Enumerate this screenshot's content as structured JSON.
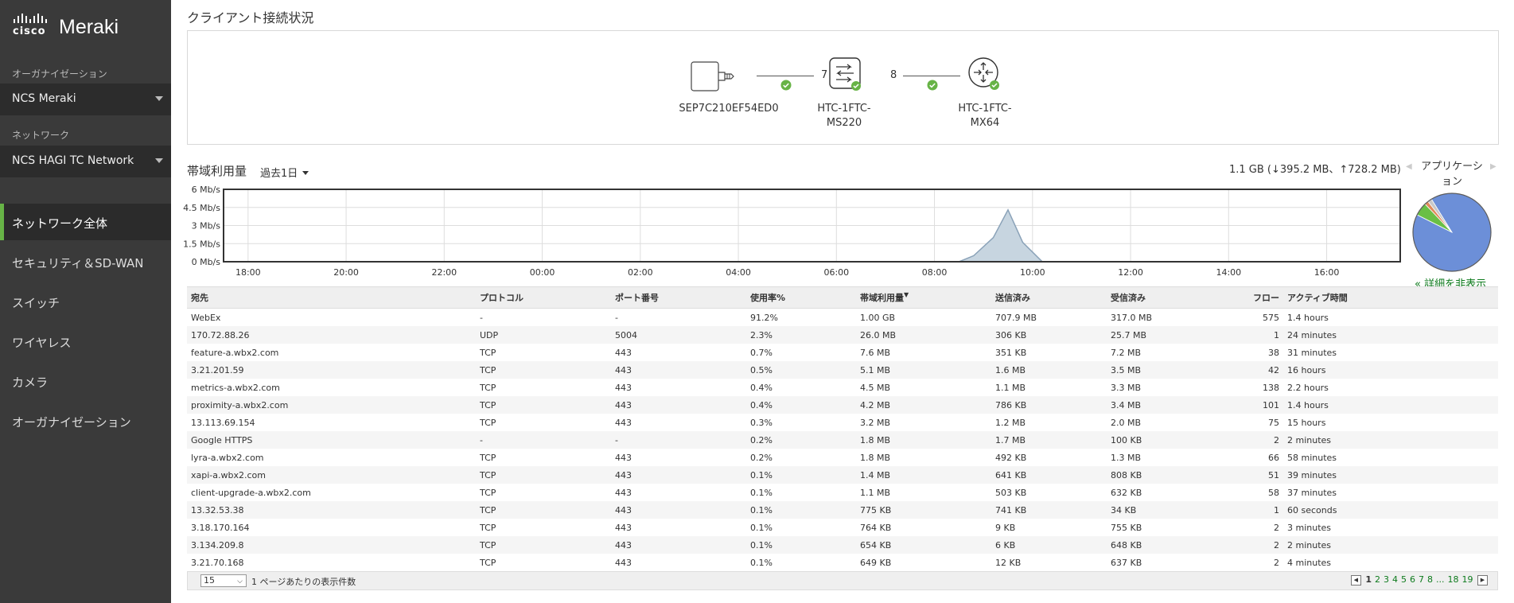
{
  "sidebar": {
    "logo_cisco": "cisco",
    "logo_meraki": "Meraki",
    "org_section_label": "オーガナイゼーション",
    "org_select": "NCS Meraki",
    "network_section_label": "ネットワーク",
    "network_select": "NCS HAGI TC Network",
    "nav": [
      {
        "label": "ネットワーク全体",
        "active": true
      },
      {
        "label": "セキュリティ＆SD-WAN",
        "active": false
      },
      {
        "label": "スイッチ",
        "active": false
      },
      {
        "label": "ワイヤレス",
        "active": false
      },
      {
        "label": "カメラ",
        "active": false
      },
      {
        "label": "オーガナイゼーション",
        "active": false
      }
    ]
  },
  "main": {
    "page_title": "クライアント接続状況",
    "topology": {
      "client": "SEP7C210EF54ED0",
      "link1_count": "7",
      "switch_line1": "HTC-1FTC-",
      "switch_line2": "MS220",
      "link2_count": "8",
      "appliance_line1": "HTC-1FTC-",
      "appliance_line2": "MX64"
    },
    "bandwidth": {
      "title": "帯域利用量",
      "range": "過去1日",
      "total": "1.1 GB (↓395.2 MB、↑728.2 MB)"
    },
    "app_panel": {
      "title": "アプリケーション",
      "nav_left": "◀",
      "nav_right": "▶",
      "hide_link": "« 詳細を非表示"
    },
    "table": {
      "columns": [
        "宛先",
        "プロトコル",
        "ポート番号",
        "使用率%",
        "帯域利用量",
        "送信済み",
        "受信済み",
        "フロー",
        "アクティブ時間"
      ],
      "sort_indicator": "▼",
      "rows": [
        [
          "WebEx",
          "-",
          "-",
          "91.2%",
          "1.00 GB",
          "707.9 MB",
          "317.0 MB",
          "575",
          "1.4 hours"
        ],
        [
          "170.72.88.26",
          "UDP",
          "5004",
          "2.3%",
          "26.0 MB",
          "306 KB",
          "25.7 MB",
          "1",
          "24 minutes"
        ],
        [
          "feature-a.wbx2.com",
          "TCP",
          "443",
          "0.7%",
          "7.6 MB",
          "351 KB",
          "7.2 MB",
          "38",
          "31 minutes"
        ],
        [
          "3.21.201.59",
          "TCP",
          "443",
          "0.5%",
          "5.1 MB",
          "1.6 MB",
          "3.5 MB",
          "42",
          "16 hours"
        ],
        [
          "metrics-a.wbx2.com",
          "TCP",
          "443",
          "0.4%",
          "4.5 MB",
          "1.1 MB",
          "3.3 MB",
          "138",
          "2.2 hours"
        ],
        [
          "proximity-a.wbx2.com",
          "TCP",
          "443",
          "0.4%",
          "4.2 MB",
          "786 KB",
          "3.4 MB",
          "101",
          "1.4 hours"
        ],
        [
          "13.113.69.154",
          "TCP",
          "443",
          "0.3%",
          "3.2 MB",
          "1.2 MB",
          "2.0 MB",
          "75",
          "15 hours"
        ],
        [
          "Google HTTPS",
          "-",
          "-",
          "0.2%",
          "1.8 MB",
          "1.7 MB",
          "100 KB",
          "2",
          "2 minutes"
        ],
        [
          "lyra-a.wbx2.com",
          "TCP",
          "443",
          "0.2%",
          "1.8 MB",
          "492 KB",
          "1.3 MB",
          "66",
          "58 minutes"
        ],
        [
          "xapi-a.wbx2.com",
          "TCP",
          "443",
          "0.1%",
          "1.4 MB",
          "641 KB",
          "808 KB",
          "51",
          "39 minutes"
        ],
        [
          "client-upgrade-a.wbx2.com",
          "TCP",
          "443",
          "0.1%",
          "1.1 MB",
          "503 KB",
          "632 KB",
          "58",
          "37 minutes"
        ],
        [
          "13.32.53.38",
          "TCP",
          "443",
          "0.1%",
          "775 KB",
          "741 KB",
          "34 KB",
          "1",
          "60 seconds"
        ],
        [
          "3.18.170.164",
          "TCP",
          "443",
          "0.1%",
          "764 KB",
          "9 KB",
          "755 KB",
          "2",
          "3 minutes"
        ],
        [
          "3.134.209.8",
          "TCP",
          "443",
          "0.1%",
          "654 KB",
          "6 KB",
          "648 KB",
          "2",
          "2 minutes"
        ],
        [
          "3.21.70.168",
          "TCP",
          "443",
          "0.1%",
          "649 KB",
          "12 KB",
          "637 KB",
          "2",
          "4 minutes"
        ]
      ]
    },
    "footer": {
      "per_page_value": "15",
      "per_page_label": "1 ページあたりの表示件数",
      "prev": "◀",
      "next": "▶",
      "pages": [
        "1",
        "2",
        "3",
        "4",
        "5",
        "6",
        "7",
        "8",
        "...",
        "18",
        "19"
      ],
      "current_page": "1"
    }
  },
  "colors": {
    "sidebar_bg": "#3a3a3a",
    "accent_green": "#67b346",
    "link_green": "#0d7a1c",
    "chart_area": "#c7d5e0",
    "chart_line": "#8aa2b8",
    "pie_main": "#6c8fd8",
    "pie_second": "#6abf45"
  },
  "chart_data": {
    "type": "area",
    "ylabel": "",
    "xlabel": "",
    "y_ticks": [
      "0 Mb/s",
      "1.5 Mb/s",
      "3 Mb/s",
      "4.5 Mb/s",
      "6 Mb/s"
    ],
    "ylim": [
      0,
      6
    ],
    "x_ticks": [
      "18:00",
      "20:00",
      "22:00",
      "00:00",
      "02:00",
      "04:00",
      "06:00",
      "08:00",
      "10:00",
      "12:00",
      "14:00",
      "16:00"
    ],
    "x_hours": [
      17.5,
      8.5,
      8.8,
      9.2,
      9.5,
      9.8,
      10.2,
      17.2
    ],
    "values": [
      0,
      0,
      0.5,
      2.0,
      4.3,
      1.6,
      0,
      0
    ],
    "grid": true,
    "pie": {
      "slices": [
        {
          "label": "WebEx",
          "value": 91.2,
          "color": "#6c8fd8"
        },
        {
          "label": "other-green",
          "value": 5.5,
          "color": "#6abf45"
        },
        {
          "label": "other-orange",
          "value": 1.6,
          "color": "#e08b5c"
        },
        {
          "label": "other-gray",
          "value": 1.7,
          "color": "#c8c8c8"
        }
      ]
    }
  }
}
